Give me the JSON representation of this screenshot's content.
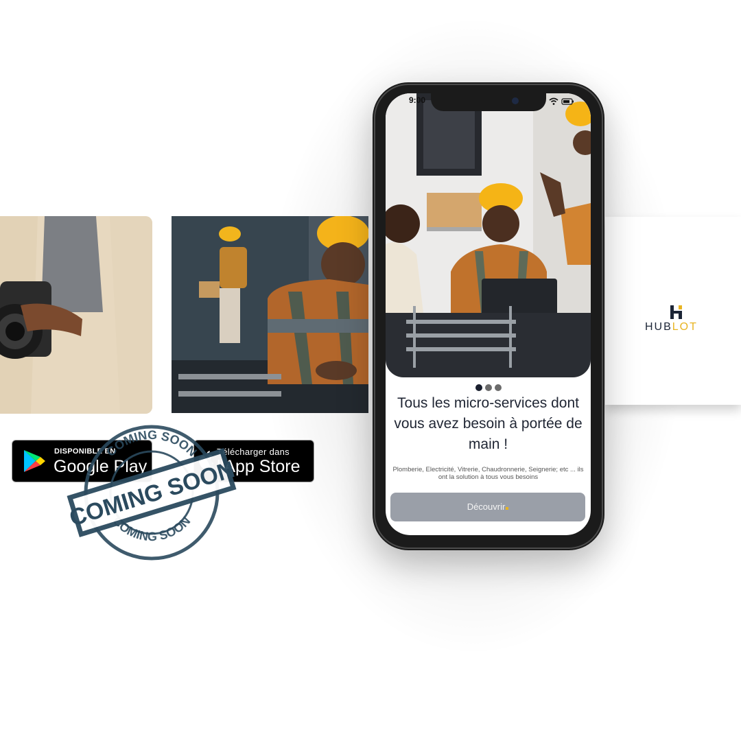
{
  "phone": {
    "status_time": "9:00",
    "onboarding": {
      "title": "Tous les micro-services dont vous avez besoin à portée de main !",
      "description": "Plomberie, Electricité, Vitrerie, Chaudronnerie, Seignerie; etc ... ils ont la solution à tous vous besoins",
      "cta_label": "Découvrir",
      "page_dots": 3,
      "active_dot": 0
    }
  },
  "badges": {
    "google_play": {
      "small": "DISPONIBLE EN",
      "big": "Google Play"
    },
    "app_store": {
      "small": "Télécharger dans",
      "big": "l'App Store"
    }
  },
  "stamp": {
    "text": "COMING SOON"
  },
  "logo": {
    "brand_part1": "HUB",
    "brand_part2": "LOT"
  },
  "colors": {
    "accent": "#e8b422",
    "dark": "#1c2536",
    "stamp": "#2b4a5e",
    "button": "#9a9fa8"
  },
  "icons": [
    "wifi-icon",
    "battery-icon",
    "google-play-icon",
    "apple-icon",
    "hublot-logo-icon",
    "camera-image",
    "worker-image"
  ]
}
